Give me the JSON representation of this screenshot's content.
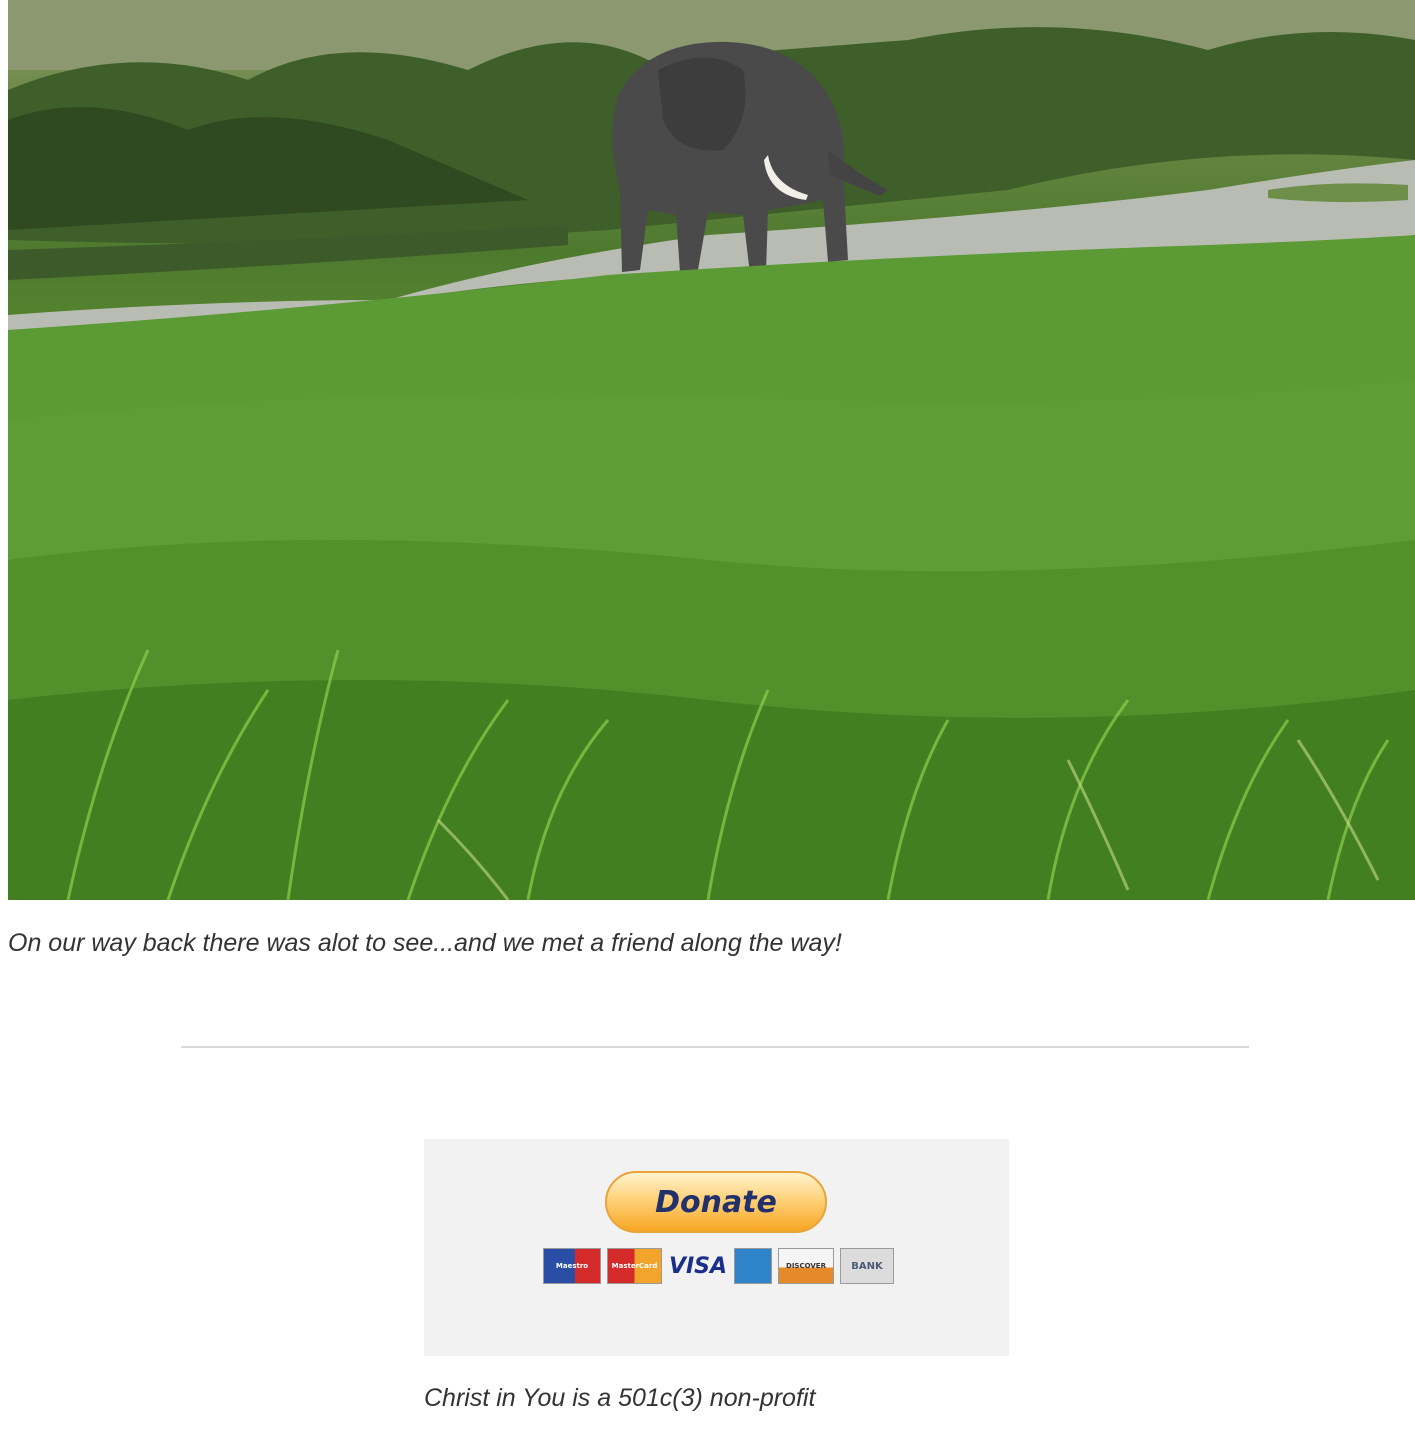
{
  "caption": "On our way back there was alot to see...and we met a friend along the way!",
  "donate": {
    "button_label": "Donate",
    "cards": [
      {
        "name": "Maestro",
        "label": "Maestro"
      },
      {
        "name": "MasterCard",
        "label": "MasterCard"
      },
      {
        "name": "Visa",
        "label": "VISA"
      },
      {
        "name": "American Express",
        "label": ""
      },
      {
        "name": "Discover",
        "label": "DISCOVER"
      },
      {
        "name": "Bank",
        "label": "BANK"
      }
    ]
  },
  "nonprofit_note": "Christ in You is a 501c(3) non-profit"
}
